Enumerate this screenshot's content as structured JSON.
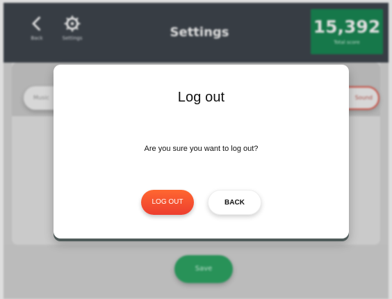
{
  "background": {
    "back_nav_label": "Back",
    "settings_nav_label": "Settings",
    "title": "Settings",
    "score": "15,392",
    "score_caption": "Total score",
    "left_pill_text": "Music",
    "right_pill_text": "Sound",
    "bottom_button_label": "Save"
  },
  "icons": {
    "back": "back-arrow-icon",
    "settings": "gear-icon"
  },
  "dialog": {
    "title": "Log out",
    "message": "Are you sure you want to log out?",
    "logout_button": "LOG OUT",
    "back_button": "BACK"
  },
  "colors": {
    "topbar": "#40474f",
    "score_badge": "#1a8a55",
    "logout_accent": "#ed3e2f",
    "save_button": "#2ea866",
    "dialog_background": "#ffffff"
  }
}
